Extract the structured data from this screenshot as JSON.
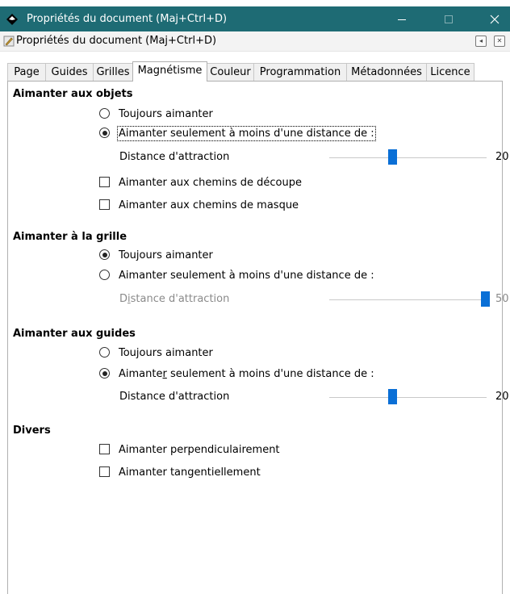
{
  "window": {
    "title": "Propriétés du document (Maj+Ctrl+D)",
    "title_bar_color": "#1e6b74"
  },
  "dock": {
    "title": "Propriétés du document (Maj+Ctrl+D)"
  },
  "tabs": [
    {
      "label": "Page",
      "active": false
    },
    {
      "label": "Guides",
      "active": false
    },
    {
      "label": "Grilles",
      "active": false
    },
    {
      "label": "Magnétisme",
      "active": true
    },
    {
      "label": "Couleur",
      "active": false
    },
    {
      "label": "Programmation",
      "active": false
    },
    {
      "label": "Métadonnées",
      "active": false
    },
    {
      "label": "Licence",
      "active": false
    }
  ],
  "objects": {
    "heading": "Aimanter aux objets",
    "always_label": "Toujours aimanter",
    "within_label": "Aimanter seulement à moins d'une distance de :",
    "selected": "within",
    "distance_label": "Distance d'attraction",
    "distance_value": "20",
    "distance_fraction": 0.4,
    "clip_label": "Aimanter aux chemins de découpe",
    "clip_checked": false,
    "mask_label": "Aimanter aux chemins de masque",
    "mask_checked": false
  },
  "grid": {
    "heading": "Aimanter à la grille",
    "always_label": "Toujours aimanter",
    "within_label": "Aimanter seulement à moins d'une distance de :",
    "selected": "always",
    "distance_label_pre": "D",
    "distance_label_mnemonic": "i",
    "distance_label_post": "stance d'attraction",
    "distance_value": "50",
    "distance_fraction": 1.0,
    "distance_enabled": false
  },
  "guides": {
    "heading": "Aimanter aux guides",
    "always_label": "Toujours aimanter",
    "within_label_pre": "Aimante",
    "within_label_mnemonic": "r",
    "within_label_post": " seulement à moins d'une distance de :",
    "selected": "within",
    "distance_label": "Distance d'attraction",
    "distance_value": "20",
    "distance_fraction": 0.4
  },
  "misc": {
    "heading": "Divers",
    "perpendicular_label": "Aimanter perpendiculairement",
    "perpendicular_checked": false,
    "tangential_label": "Aimanter tangentiellement",
    "tangential_checked": false
  },
  "icons": {
    "app": "inkscape-icon",
    "dock": "document-properties-icon",
    "minimize": "minimize-icon",
    "maximize": "maximize-icon",
    "close": "close-icon",
    "dock_back": "dock-back-icon",
    "dock_close": "dock-close-icon"
  },
  "colors": {
    "slider_thumb": "#0a6fd6",
    "disabled_text": "#8a8a8a"
  }
}
